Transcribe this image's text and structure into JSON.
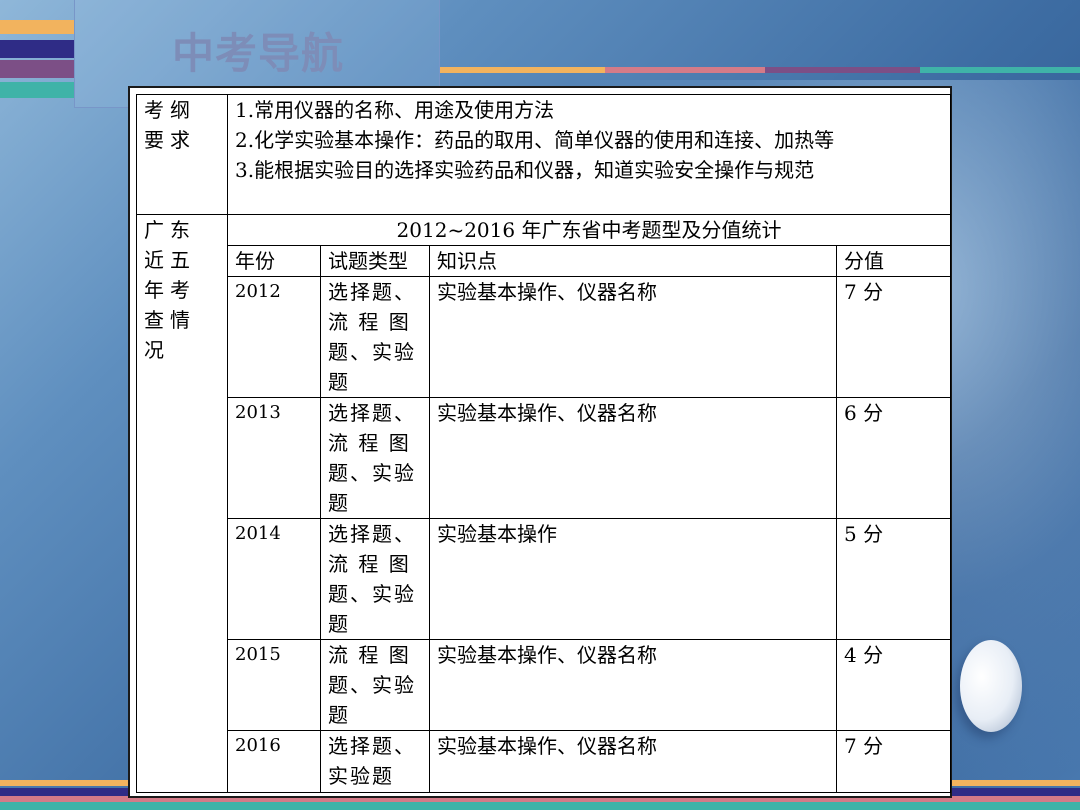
{
  "page_title": "中考导航",
  "table": {
    "requirements_label": "考纲要求",
    "requirements": [
      "1.常用仪器的名称、用途及使用方法",
      "2.化学实验基本操作：药品的取用、简单仪器的使用和连接、加热等",
      "3.能根据实验目的选择实验药品和仪器，知道实验安全操作与规范"
    ],
    "exam_label": "广东近五年考查情况",
    "stats_title": "2012~2016 年广东省中考题型及分值统计",
    "headers": {
      "year": "年份",
      "type": "试题类型",
      "knowledge": "知识点",
      "score": "分值"
    },
    "rows": [
      {
        "year": "2012",
        "type": [
          "选择题、",
          "流 程 图",
          "题、实验",
          "题"
        ],
        "knowledge": "实验基本操作、仪器名称",
        "score": "7 分"
      },
      {
        "year": "2013",
        "type": [
          "选择题、",
          "流 程 图",
          "题、实验",
          "题"
        ],
        "knowledge": "实验基本操作、仪器名称",
        "score": "6 分"
      },
      {
        "year": "2014",
        "type": [
          "选择题、",
          "流 程 图",
          "题、实验",
          "题"
        ],
        "knowledge": "实验基本操作",
        "score": "5 分"
      },
      {
        "year": "2015",
        "type": [
          "流 程 图",
          "题、实验",
          "题"
        ],
        "knowledge": "实验基本操作、仪器名称",
        "score": "4 分"
      },
      {
        "year": "2016",
        "type": [
          "选择题、",
          "实验题"
        ],
        "knowledge": "实验基本操作、仪器名称",
        "score": "7 分"
      }
    ]
  }
}
